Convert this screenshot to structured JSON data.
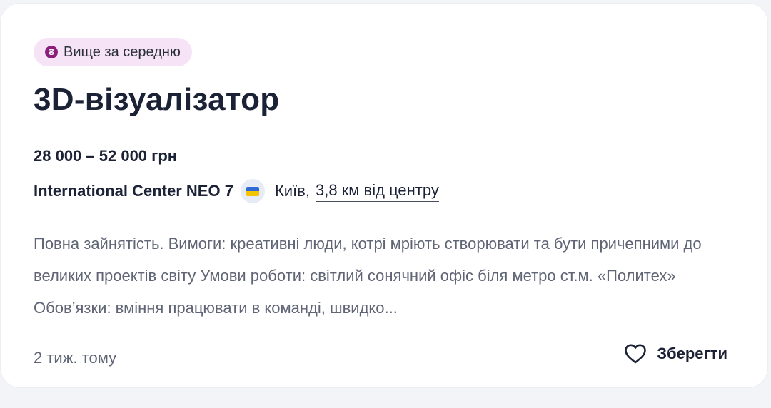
{
  "badge": {
    "icon": "hryvnia-icon",
    "icon_glyph": "₴",
    "label": "Вище за середню"
  },
  "vacancy": {
    "title": "3D-візуалізатор",
    "salary": "28 000 – 52 000 грн",
    "company": "International Center NEO 7",
    "flag_icon": "ukraine-flag-icon",
    "city": "Київ,",
    "distance": "3,8 км від центру",
    "description": "Повна зайнятість. Вимоги: креативні люди, котрі мріють створювати та бути причепними до великих проектів світу Умови роботи: світлий сонячний офіс біля метро ст.м. «Политех» Обов’язки: вміння працювати в команді, швидко...",
    "posted": "2 тиж. тому"
  },
  "actions": {
    "save_label": "Зберегти",
    "save_icon": "heart-icon"
  },
  "colors": {
    "badge_bg": "#f6e4f6",
    "badge_icon": "#8a1e7c",
    "text_primary": "#1c2236",
    "text_secondary": "#5f6575"
  }
}
